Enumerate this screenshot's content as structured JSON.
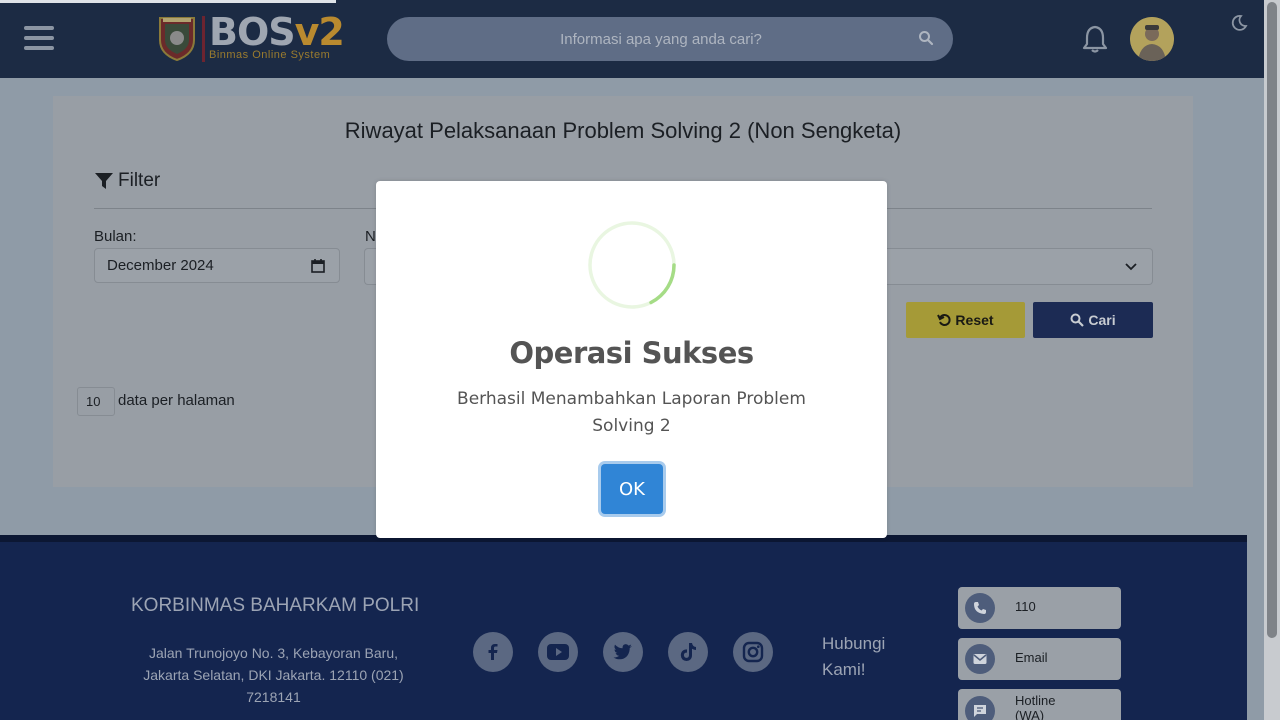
{
  "header": {
    "logo": {
      "name": "BOS",
      "version": "v2",
      "subtitle": "Binmas Online System"
    },
    "search": {
      "placeholder": "Informasi apa yang anda cari?"
    },
    "icons": {
      "menu": "hamburger-icon",
      "search": "search-icon",
      "notifications": "bell-icon",
      "theme": "moon-icon"
    }
  },
  "page": {
    "title": "Riwayat Pelaksanaan Problem Solving 2 (Non Sengketa)",
    "filter": {
      "heading": "Filter",
      "month_label": "Bulan:",
      "month_value": "December 2024",
      "second_label_fragment": "N",
      "reset_label": "Reset",
      "search_label": "Cari"
    },
    "table": {
      "per_page_value": "10",
      "per_page_label": "data per halaman"
    }
  },
  "footer": {
    "org_name": "KORBINMAS BAHARKAM POLRI",
    "address": "Jalan Trunojoyo No. 3, Kebayoran Baru, Jakarta Selatan, DKI Jakarta. 12110 (021) 7218141",
    "social_icons": [
      "facebook-icon",
      "youtube-icon",
      "twitter-icon",
      "tiktok-icon",
      "instagram-icon"
    ],
    "contact_heading": "Hubungi Kami!",
    "contacts": [
      {
        "icon": "phone-icon",
        "label": "110"
      },
      {
        "icon": "mail-icon",
        "label": "Email"
      },
      {
        "icon": "chat-icon",
        "label": "Hotline (WA)"
      }
    ]
  },
  "modal": {
    "title": "Operasi Sukses",
    "message": "Berhasil Menambahkan Laporan Problem Solving 2",
    "ok_label": "OK",
    "icon": "success-spinner-icon"
  },
  "colors": {
    "header_bg": "#1c2b44",
    "footer_bg": "#14254f",
    "reset_button": "#a59a37",
    "search_button": "#1c2b54",
    "ok_button": "#3085d6",
    "spinner_accent": "#a5dc86"
  }
}
